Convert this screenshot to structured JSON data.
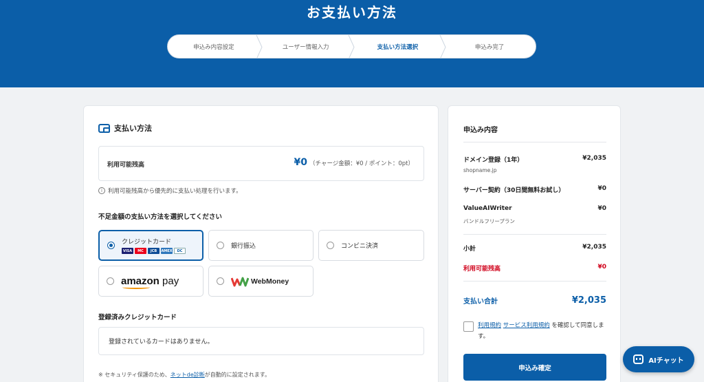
{
  "header": {
    "title": "お支払い方法"
  },
  "steps": [
    {
      "label": "申込み内容設定"
    },
    {
      "label": "ユーザー情報入力"
    },
    {
      "label": "支払い方法選択"
    },
    {
      "label": "申込み完了"
    }
  ],
  "payment": {
    "section_title": "支払い方法",
    "balance_label": "利用可能残高",
    "balance_amount": "¥0",
    "balance_detail": "（チャージ金額：¥0 / ポイント：0pt）",
    "balance_note": "利用可能残高から優先的に支払い処理を行います。",
    "method_heading": "不足金額の支払い方法を選択してください",
    "options": {
      "credit": "クレジットカード",
      "bank": "銀行振込",
      "convenience": "コンビニ決済",
      "amazon_word": "amazon",
      "amazon_pay": " pay",
      "webmoney": "WebMoney"
    },
    "card_brands": [
      "VISA",
      "MC",
      "JCB",
      "AMEX",
      "DC"
    ],
    "registered_heading": "登録済みクレジットカード",
    "registered_empty": "登録されているカードはありません。",
    "footnote_prefix": "※ セキュリティ保護のため、",
    "footnote_link": "ネットde診断",
    "footnote_suffix": "が自動的に設定されます。"
  },
  "summary": {
    "title": "申込み内容",
    "items": [
      {
        "name": "ドメイン登録（1年）",
        "price": "¥2,035",
        "sub": "shopname.jp"
      },
      {
        "name": "サーバー契約（30日間無料お試し）",
        "price": "¥0"
      },
      {
        "name": "ValueAIWriter",
        "price": "¥0",
        "sub": "バンドルフリープラン"
      }
    ],
    "subtotal_label": "小計",
    "subtotal": "¥2,035",
    "balance_label": "利用可能残高",
    "balance": "¥0",
    "total_label": "支払い合計",
    "total": "¥2,035",
    "terms_link_1": "利用規約",
    "terms_link_2": "サービス利用規約",
    "terms_text": " を確認して同意します。",
    "submit_label": "申込み確定"
  },
  "chat": {
    "label": "AIチャット"
  },
  "colors": {
    "brand": "#0b5ea8",
    "alert": "#d0021b"
  }
}
